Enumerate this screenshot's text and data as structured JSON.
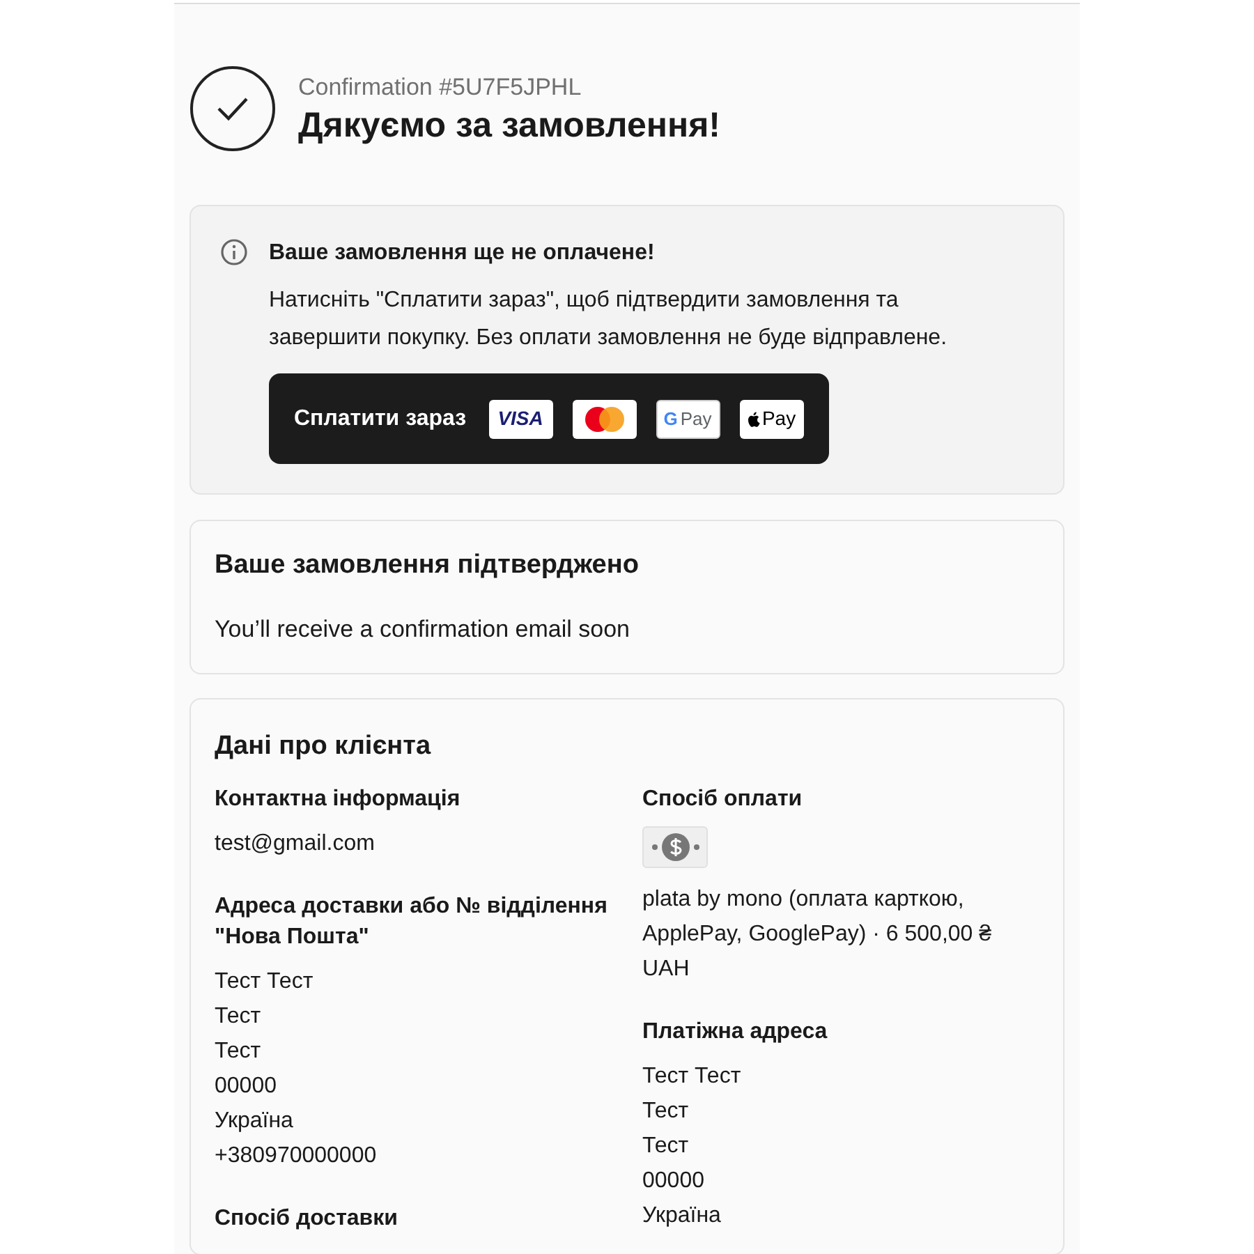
{
  "header": {
    "confirmation": "Confirmation #5U7F5JPHL",
    "title": "Дякуємо за замовлення!"
  },
  "notice": {
    "title": "Ваше замовлення ще не оплачене!",
    "text": "Натисніть \"Сплатити зараз\", щоб підтвердити замовлення та завершити покупку. Без оплати замовлення не буде відправлене.",
    "pay_button": "Сплатити зараз",
    "payment_logos": [
      {
        "kind": "visa",
        "label": "VISA"
      },
      {
        "kind": "mastercard"
      },
      {
        "kind": "google_pay",
        "mark": "G",
        "label": "Pay"
      },
      {
        "kind": "apple_pay",
        "label": "Pay"
      }
    ]
  },
  "confirmed": {
    "title": "Ваше замовлення підтверджено",
    "text": "You’ll receive a confirmation email soon"
  },
  "customer": {
    "title": "Дані про клієнта",
    "left": [
      {
        "heading": "Контактна інформація",
        "lines": [
          "test@gmail.com"
        ]
      },
      {
        "heading": "Адреса доставки або № відділення \"Нова Пошта\"",
        "lines": [
          "Тест Тест",
          "Тест",
          "Тест",
          "00000",
          "Україна",
          "+380970000000"
        ]
      },
      {
        "heading": "Спосіб доставки"
      }
    ],
    "right": [
      {
        "heading": "Спосіб оплати",
        "kind": "payment",
        "lines": [
          "plata by mono (оплата карткою, ApplePay, GooglePay) · 6 500,00 ₴ UAH"
        ]
      },
      {
        "heading": "Платіжна адреса",
        "lines": [
          "Тест Тест",
          "Тест",
          "Тест",
          "00000",
          "Україна"
        ]
      }
    ]
  }
}
